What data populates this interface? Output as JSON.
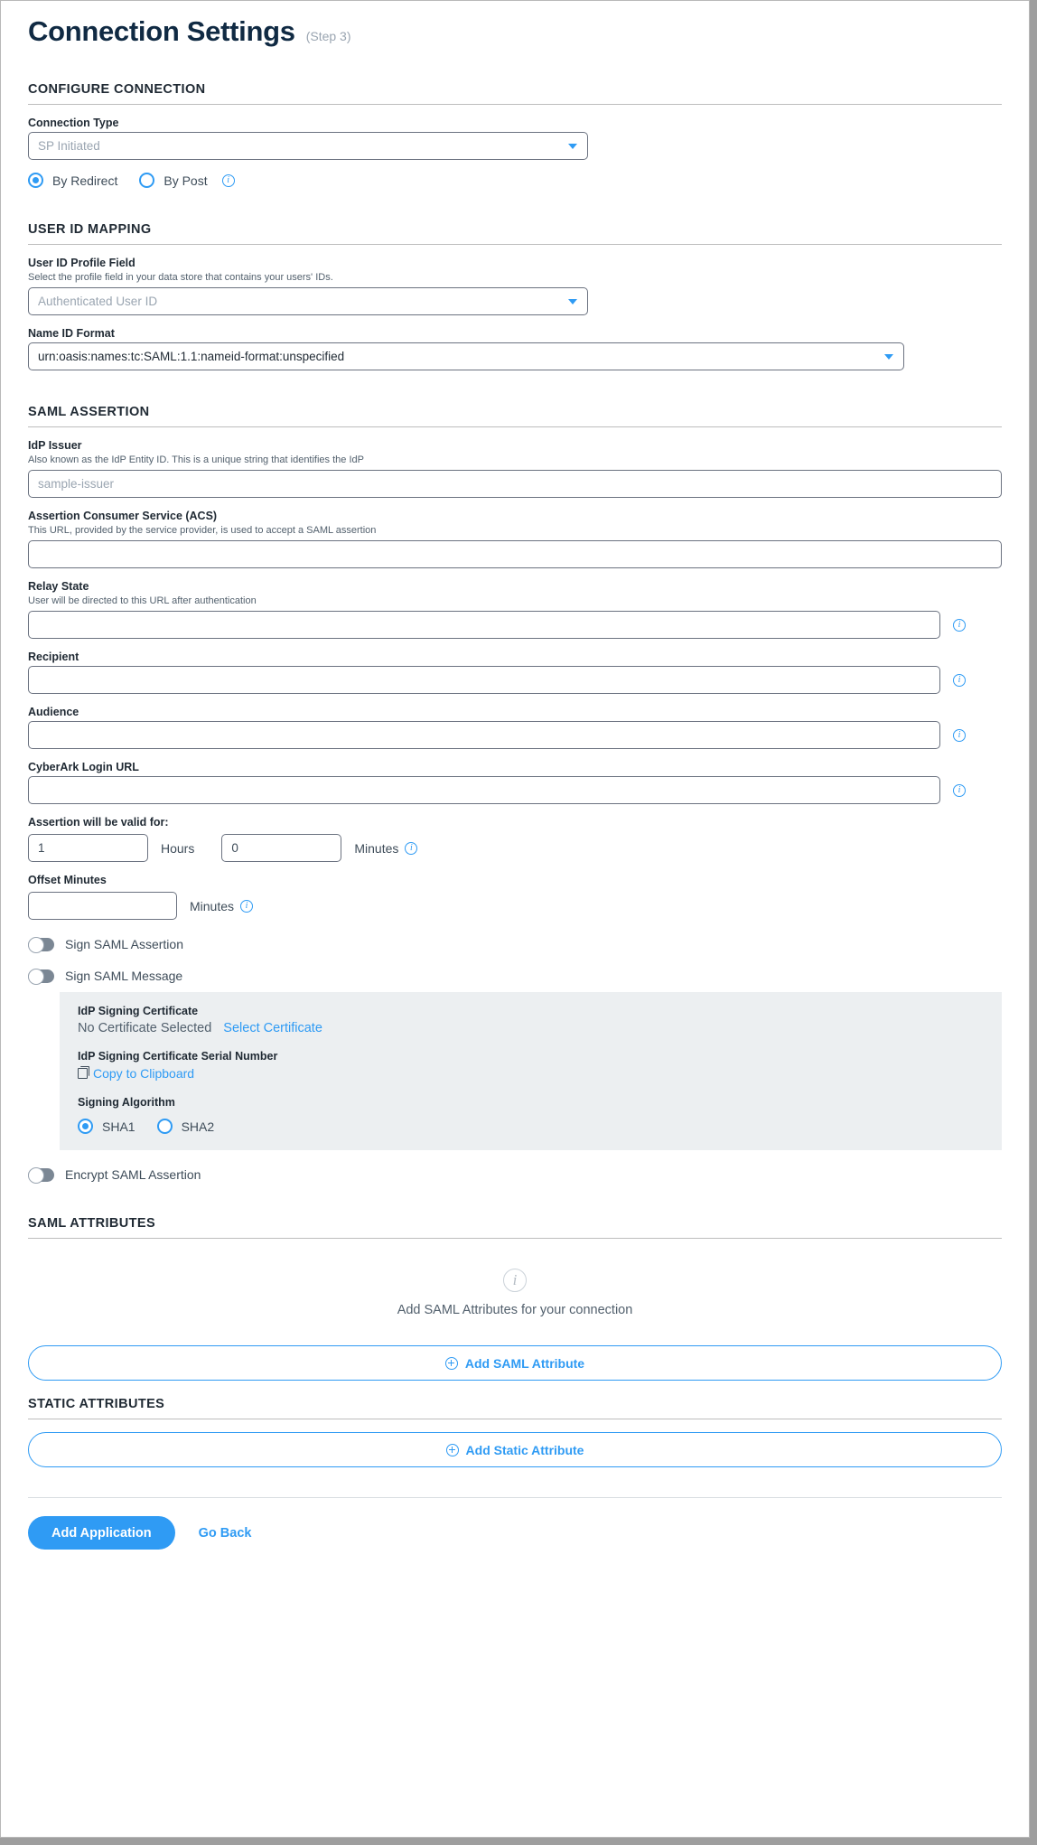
{
  "header": {
    "title": "Connection Settings",
    "step": "(Step 3)"
  },
  "configure_connection": {
    "heading": "CONFIGURE CONNECTION",
    "connection_type": {
      "label": "Connection Type",
      "value": "SP Initiated"
    },
    "binding": {
      "options": [
        {
          "label": "By Redirect",
          "selected": true
        },
        {
          "label": "By Post",
          "selected": false
        }
      ]
    }
  },
  "user_id_mapping": {
    "heading": "USER ID MAPPING",
    "profile_field": {
      "label": "User ID Profile Field",
      "help": "Select the profile field in your data store that contains your users' IDs.",
      "value": "Authenticated User ID"
    },
    "name_id_format": {
      "label": "Name ID Format",
      "value": "urn:oasis:names:tc:SAML:1.1:nameid-format:unspecified"
    }
  },
  "saml_assertion": {
    "heading": "SAML ASSERTION",
    "idp_issuer": {
      "label": "IdP Issuer",
      "help": "Also known as the IdP Entity ID. This is a unique string that identifies the IdP",
      "value": "",
      "placeholder": "sample-issuer"
    },
    "acs": {
      "label": "Assertion Consumer Service (ACS)",
      "help": "This URL, provided by the service provider, is used to accept a SAML assertion",
      "value": ""
    },
    "relay_state": {
      "label": "Relay State",
      "help": "User will be directed to this URL after authentication",
      "value": ""
    },
    "recipient": {
      "label": "Recipient",
      "value": ""
    },
    "audience": {
      "label": "Audience",
      "value": ""
    },
    "cyberark_login_url": {
      "label": "CyberArk Login URL",
      "value": ""
    },
    "validity": {
      "label": "Assertion will be valid for:",
      "hours_value": "1",
      "hours_unit": "Hours",
      "minutes_value": "0",
      "minutes_unit": "Minutes"
    },
    "offset": {
      "label": "Offset Minutes",
      "value": "",
      "unit": "Minutes"
    },
    "sign_saml_assertion": {
      "label": "Sign SAML Assertion",
      "on": false
    },
    "sign_saml_message": {
      "label": "Sign SAML Message",
      "on": false
    },
    "encrypt_saml_assertion": {
      "label": "Encrypt SAML Assertion",
      "on": false
    },
    "certificate": {
      "cert_label": "IdP Signing Certificate",
      "cert_value": "No Certificate Selected",
      "select_link": "Select Certificate",
      "serial_label": "IdP Signing Certificate Serial Number",
      "copy_link": "Copy to Clipboard",
      "algorithm_label": "Signing Algorithm",
      "algorithms": [
        {
          "label": "SHA1",
          "selected": true
        },
        {
          "label": "SHA2",
          "selected": false
        }
      ]
    }
  },
  "saml_attributes": {
    "heading": "SAML ATTRIBUTES",
    "empty_text": "Add SAML Attributes for your connection",
    "add_label": "Add SAML Attribute"
  },
  "static_attributes": {
    "heading": "STATIC ATTRIBUTES",
    "add_label": "Add Static Attribute"
  },
  "footer": {
    "primary_label": "Add Application",
    "secondary_label": "Go Back"
  },
  "colors": {
    "accent": "#2f9bf4",
    "title": "#102a43",
    "panel_bg": "#eceff1"
  }
}
